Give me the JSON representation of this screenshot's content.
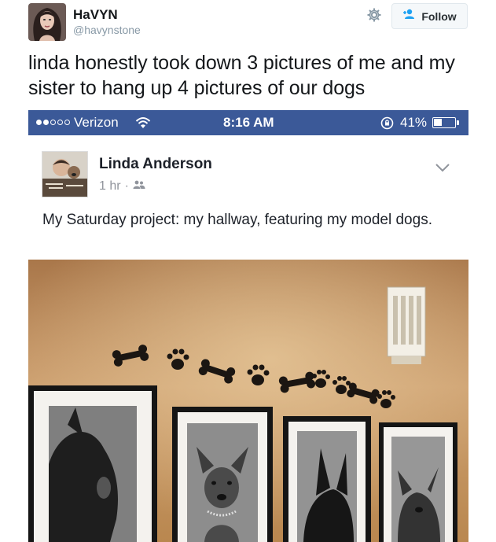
{
  "tweet": {
    "display_name": "HaVYN",
    "handle": "@havynstone",
    "follow_label": "Follow",
    "text": "linda honestly took down 3 pictures of me and my sister to hang up 4 pictures of our dogs"
  },
  "phone_status": {
    "carrier": "Verizon",
    "time": "8:16 AM",
    "battery": "41%",
    "battery_level": 0.41,
    "signal_bars_filled": 2,
    "signal_bars_total": 5
  },
  "post": {
    "author": "Linda Anderson",
    "time_ago": "1 hr",
    "separator": "·",
    "text": "My Saturday project: my hallway, featuring my model dogs."
  },
  "icons": {
    "gear": "gear-icon",
    "follow": "add-user-icon",
    "wifi": "wifi-icon",
    "rotation_lock": "rotation-lock-icon",
    "battery": "battery-icon",
    "privacy": "friends-icon",
    "chevron": "chevron-down-icon"
  },
  "colors": {
    "facebook_blue": "#3b5998",
    "twitter_gray": "#8899a6",
    "wall": "#c99c62"
  }
}
